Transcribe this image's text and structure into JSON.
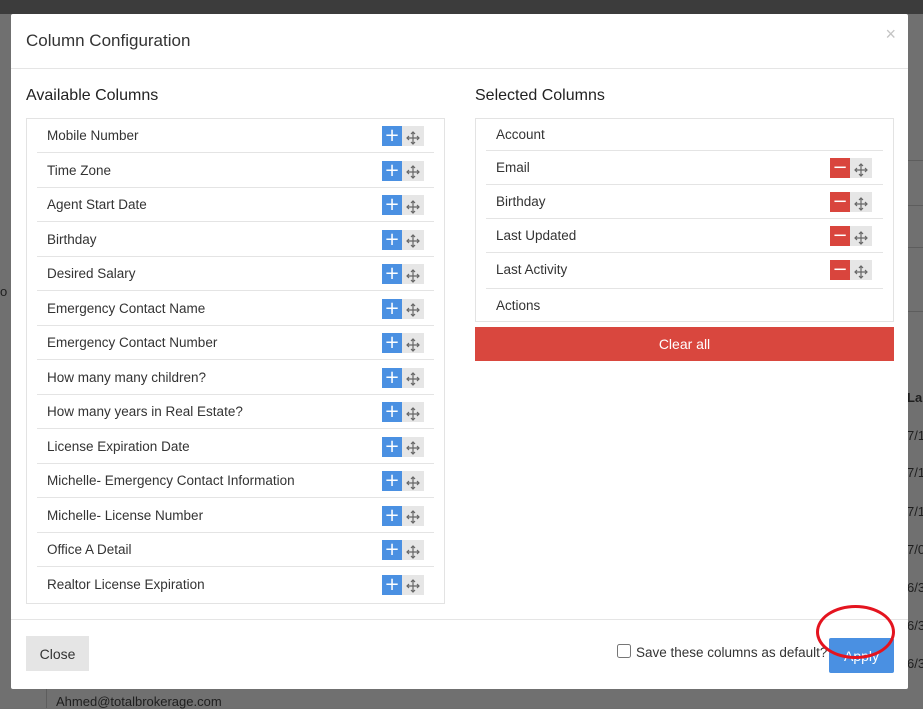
{
  "modal": {
    "title": "Column Configuration",
    "close_glyph": "×"
  },
  "available": {
    "heading": "Available Columns",
    "items": [
      {
        "label": "Mobile Number"
      },
      {
        "label": "Time Zone"
      },
      {
        "label": "Agent Start Date"
      },
      {
        "label": "Birthday"
      },
      {
        "label": "Desired Salary"
      },
      {
        "label": "Emergency Contact Name"
      },
      {
        "label": "Emergency Contact Number"
      },
      {
        "label": "How many many children?"
      },
      {
        "label": "How many years in Real Estate?"
      },
      {
        "label": "License Expiration Date"
      },
      {
        "label": "Michelle- Emergency Contact Information"
      },
      {
        "label": "Michelle- License Number"
      },
      {
        "label": "Office A Detail"
      },
      {
        "label": "Realtor License Expiration"
      }
    ],
    "add_glyph": "+",
    "add_icon": "plus-icon",
    "move_icon": "move-arrows-icon"
  },
  "selected": {
    "heading": "Selected Columns",
    "items": [
      {
        "label": "Account",
        "removable": false
      },
      {
        "label": "Email",
        "removable": true
      },
      {
        "label": "Birthday",
        "removable": true
      },
      {
        "label": "Last Updated",
        "removable": true
      },
      {
        "label": "Last Activity",
        "removable": true
      },
      {
        "label": "Actions",
        "removable": false
      }
    ],
    "remove_glyph": "−",
    "remove_icon": "minus-icon",
    "clear_label": "Clear all"
  },
  "footer": {
    "close_label": "Close",
    "default_label": "Save these columns as default?",
    "default_checked": false,
    "apply_label": "Apply"
  },
  "background": {
    "right_cells": [
      "La",
      "7/1",
      "7/1",
      "7/1",
      "7/0",
      "6/3",
      "6/3",
      "6/3"
    ],
    "left_fragment": "o",
    "email": "Ahmed@totalbrokerage.com"
  },
  "colors": {
    "primary": "#4a90e2",
    "danger": "#d9453d",
    "highlight_ring": "#e4141f"
  }
}
